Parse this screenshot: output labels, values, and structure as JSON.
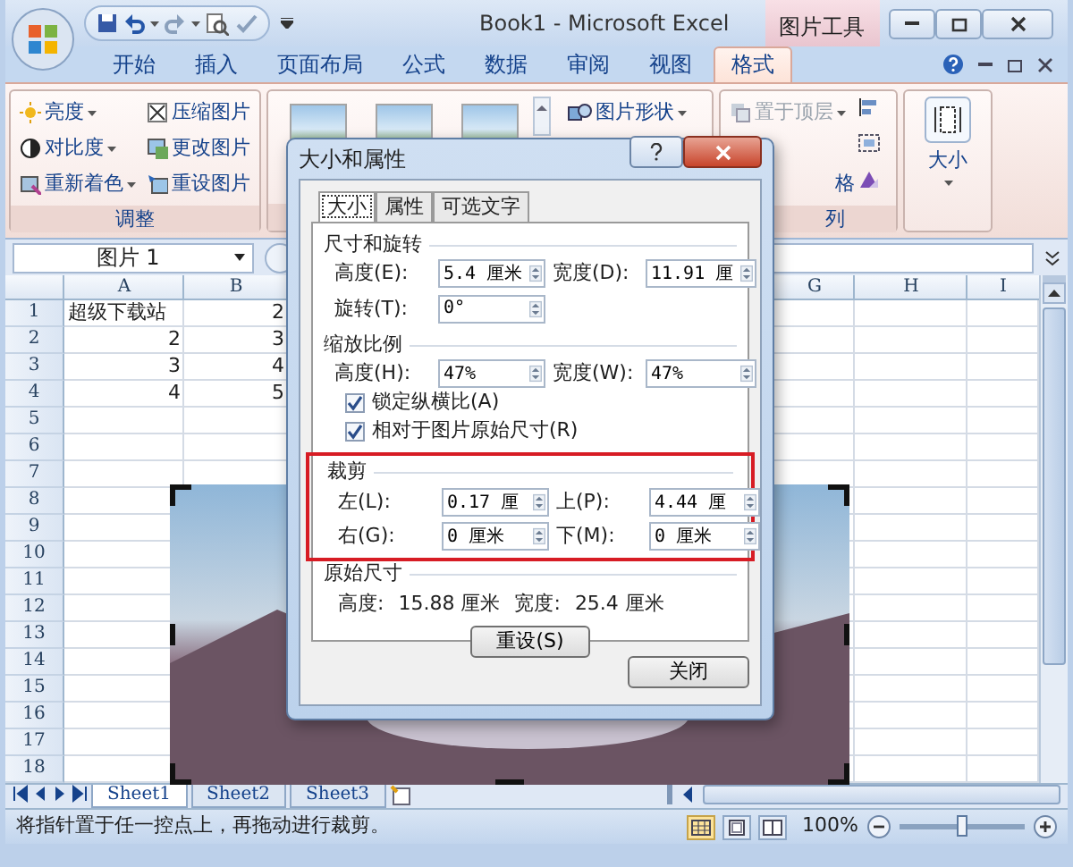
{
  "window": {
    "title": "Book1 - Microsoft Excel",
    "context_label": "图片工具"
  },
  "ribbon": {
    "tabs": [
      {
        "label": "开始",
        "selected": false
      },
      {
        "label": "插入",
        "selected": false
      },
      {
        "label": "页面布局",
        "selected": false
      },
      {
        "label": "公式",
        "selected": false
      },
      {
        "label": "数据",
        "selected": false
      },
      {
        "label": "审阅",
        "selected": false
      },
      {
        "label": "视图",
        "selected": false
      },
      {
        "label": "格式",
        "selected": true
      }
    ],
    "adjust": {
      "label": "调整",
      "items": [
        {
          "label": "亮度",
          "has_menu": true
        },
        {
          "label": "压缩图片",
          "has_menu": false
        },
        {
          "label": "对比度",
          "has_menu": true
        },
        {
          "label": "更改图片",
          "has_menu": false
        },
        {
          "label": "重新着色",
          "has_menu": true
        },
        {
          "label": "重设图片",
          "has_menu": false
        }
      ]
    },
    "styles": {
      "shape_label": "图片形状"
    },
    "arrange": {
      "label": "列",
      "items": [
        {
          "label": "置于顶层",
          "disabled": true
        },
        {
          "label": "格",
          "disabled": false
        }
      ]
    },
    "size": {
      "label": "大小"
    }
  },
  "formula_bar": {
    "name_box": "图片 1"
  },
  "sheet": {
    "columns": [
      "A",
      "B",
      "G",
      "H",
      "I"
    ],
    "rows": [
      {
        "number": "1",
        "cells": [
          {
            "value": "超级下载站",
            "kind": "text"
          },
          {
            "value": "2",
            "kind": "number"
          }
        ]
      },
      {
        "number": "2",
        "cells": [
          {
            "value": "2",
            "kind": "number"
          },
          {
            "value": "3",
            "kind": "number"
          }
        ]
      },
      {
        "number": "3",
        "cells": [
          {
            "value": "3",
            "kind": "number"
          },
          {
            "value": "4",
            "kind": "number"
          }
        ]
      },
      {
        "number": "4",
        "cells": [
          {
            "value": "4",
            "kind": "number"
          },
          {
            "value": "5",
            "kind": "number"
          }
        ]
      },
      {
        "number": "5"
      },
      {
        "number": "6"
      },
      {
        "number": "7"
      },
      {
        "number": "8"
      },
      {
        "number": "9"
      },
      {
        "number": "10"
      },
      {
        "number": "11"
      },
      {
        "number": "12"
      },
      {
        "number": "13"
      },
      {
        "number": "14"
      },
      {
        "number": "15"
      },
      {
        "number": "16"
      },
      {
        "number": "17"
      },
      {
        "number": "18"
      }
    ]
  },
  "sheet_tabs": [
    {
      "label": "Sheet1",
      "selected": true
    },
    {
      "label": "Sheet2",
      "selected": false
    },
    {
      "label": "Sheet3",
      "selected": false
    }
  ],
  "status_bar": {
    "message": "将指针置于任一控点上，再拖动进行裁剪。",
    "view_buttons": [
      {
        "selected": true
      },
      {
        "selected": false
      },
      {
        "selected": false
      }
    ],
    "zoom": "100%",
    "zoom_slider": {
      "level": 0.5
    }
  },
  "dialog": {
    "title": "大小和属性",
    "tabs": [
      {
        "label": "大小",
        "selected": true
      },
      {
        "label": "属性",
        "selected": false
      },
      {
        "label": "可选文字",
        "selected": false
      }
    ],
    "size_rotate": {
      "heading": "尺寸和旋转",
      "fields": [
        {
          "label": "高度(E):",
          "value": "5.4 厘米"
        },
        {
          "label": "宽度(D):",
          "value": "11.91 厘"
        },
        {
          "label": "旋转(T):",
          "value": "0°"
        }
      ]
    },
    "scale": {
      "heading": "缩放比例",
      "fields": [
        {
          "label": "高度(H):",
          "value": "47%"
        },
        {
          "label": "宽度(W):",
          "value": "47%"
        }
      ],
      "checkboxes": [
        {
          "label": "锁定纵横比(A)",
          "checked": true
        },
        {
          "label": "相对于图片原始尺寸(R)",
          "checked": true
        }
      ]
    },
    "crop": {
      "heading": "裁剪",
      "highlighted": true,
      "fields": [
        {
          "label": "左(L):",
          "value": "0.17 厘"
        },
        {
          "label": "上(P):",
          "value": "4.44 厘"
        },
        {
          "label": "右(G):",
          "value": "0 厘米"
        },
        {
          "label": "下(M):",
          "value": "0 厘米"
        }
      ]
    },
    "original": {
      "heading": "原始尺寸",
      "height_label": "高度:",
      "height": "15.88 厘米",
      "width_label": "宽度:",
      "width": "25.4 厘米",
      "reset": "重设(S)"
    },
    "close": "关闭"
  }
}
